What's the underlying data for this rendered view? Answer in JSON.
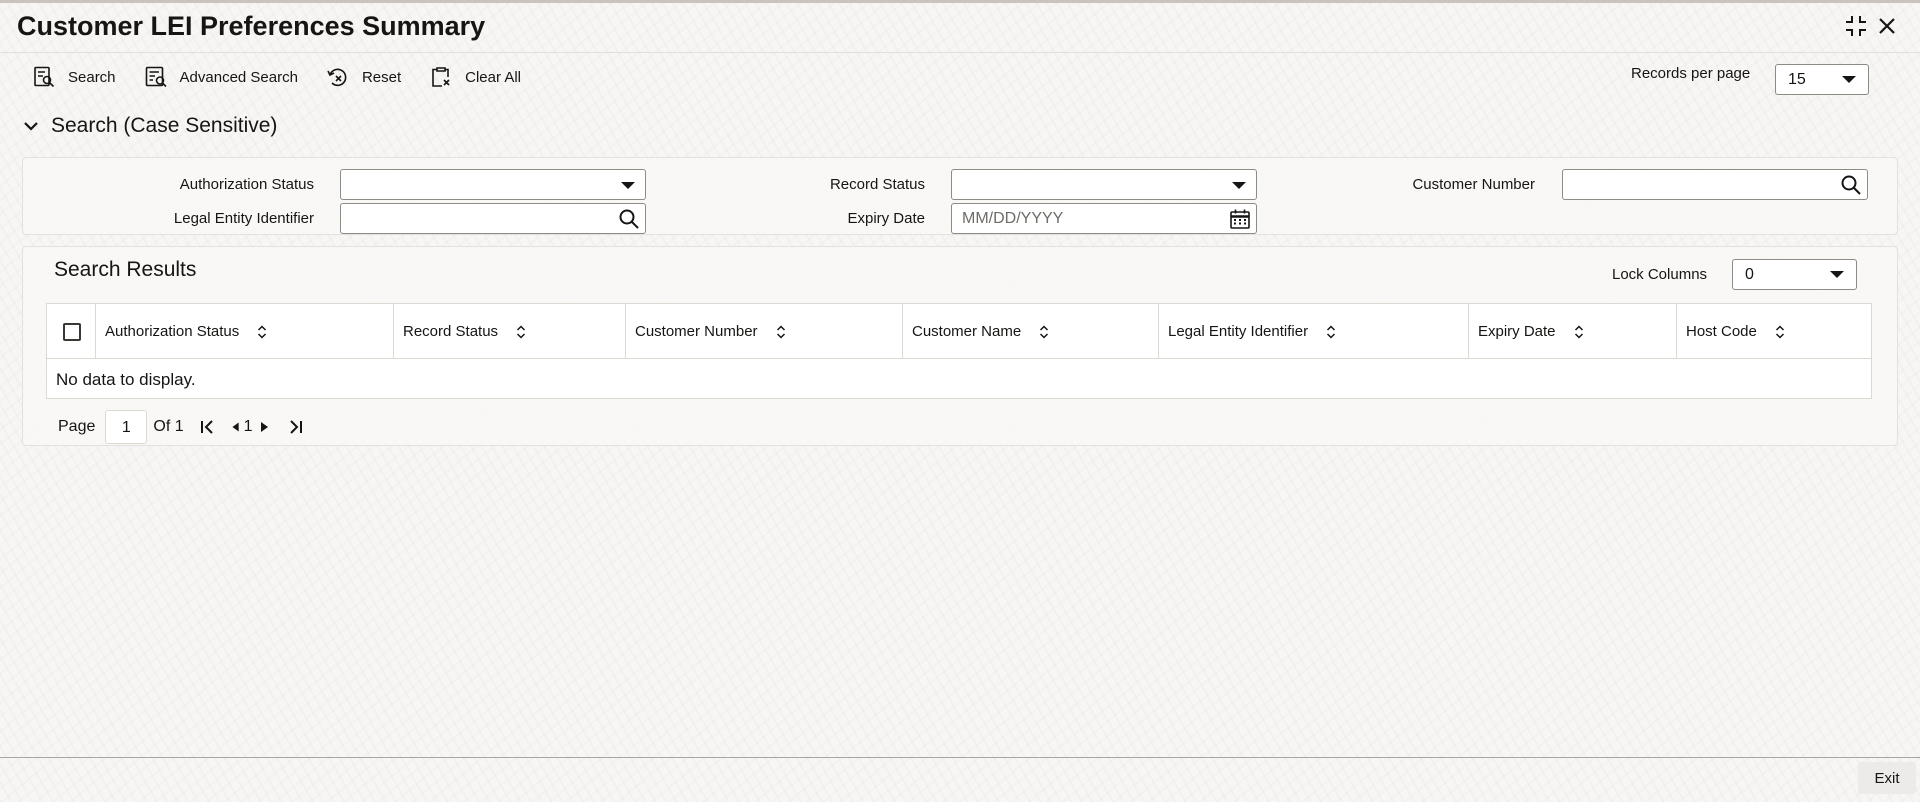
{
  "window": {
    "title": "Customer LEI Preferences Summary"
  },
  "toolbar": {
    "search_label": "Search",
    "advanced_search_label": "Advanced Search",
    "reset_label": "Reset",
    "clear_all_label": "Clear All",
    "records_per_page_label": "Records per page",
    "records_per_page_value": "15"
  },
  "search": {
    "section_title": "Search (Case Sensitive)",
    "authorization_status_label": "Authorization Status",
    "authorization_status_value": "",
    "record_status_label": "Record Status",
    "record_status_value": "",
    "customer_number_label": "Customer Number",
    "customer_number_value": "",
    "legal_entity_identifier_label": "Legal Entity Identifier",
    "legal_entity_identifier_value": "",
    "expiry_date_label": "Expiry Date",
    "expiry_date_placeholder": "MM/DD/YYYY"
  },
  "results": {
    "title": "Search Results",
    "lock_columns_label": "Lock Columns",
    "lock_columns_value": "0",
    "columns": [
      "Authorization Status",
      "Record Status",
      "Customer Number",
      "Customer Name",
      "Legal Entity Identifier",
      "Expiry Date",
      "Host Code"
    ],
    "empty_message": "No data to display."
  },
  "pagination": {
    "page_label": "Page",
    "current_page": "1",
    "of_label": "Of 1",
    "page_number": "1"
  },
  "footer": {
    "exit_label": "Exit"
  },
  "icons": {
    "collapse": "minimize-icon",
    "close": "close-icon",
    "search": "search-doc-icon",
    "advanced_search": "advanced-search-icon",
    "reset": "reset-icon",
    "clear_all": "clear-all-icon",
    "lookup": "magnifier-icon",
    "calendar": "calendar-icon"
  }
}
